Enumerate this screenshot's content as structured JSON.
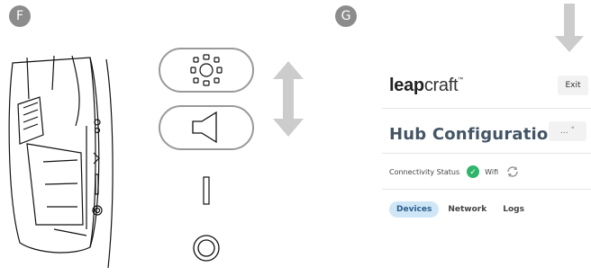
{
  "panels": {
    "left_badge": "F",
    "right_badge": "G"
  },
  "app": {
    "logo_bold": "leap",
    "logo_light": "craft",
    "logo_mark": "™",
    "exit_label": "Exit",
    "title": "Hub Configuration",
    "menu_label": "... ˅"
  },
  "status": {
    "label": "Connectivity Status",
    "wifi_label": "Wifi"
  },
  "tabs": [
    {
      "label": "Devices",
      "active": true
    },
    {
      "label": "Network",
      "active": false
    },
    {
      "label": "Logs",
      "active": false
    }
  ],
  "colors": {
    "badge": "#8c8c8c",
    "arrow": "#cccccc",
    "accent_tab": "#cfe6f7",
    "status_ok": "#2fb56b"
  },
  "icons": [
    "sun-icon",
    "speaker-icon",
    "led-slot-icon",
    "round-button-icon",
    "updown-arrow-icon",
    "down-arrow-icon",
    "check-icon",
    "refresh-icon"
  ]
}
